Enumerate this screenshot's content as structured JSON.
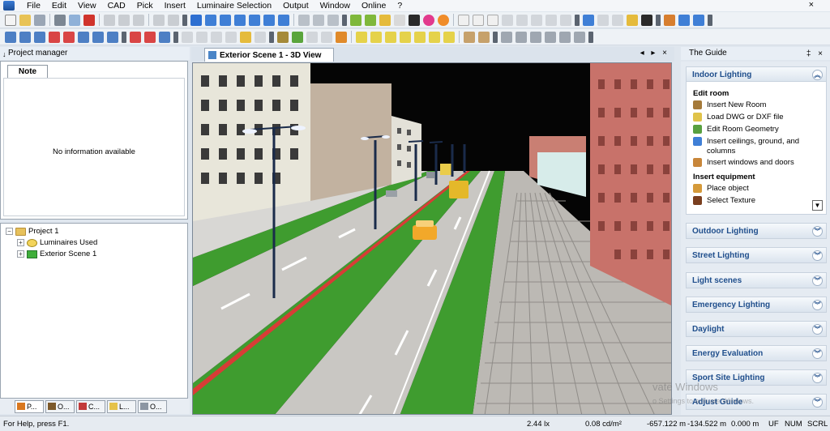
{
  "menu": {
    "items": [
      "File",
      "Edit",
      "View",
      "CAD",
      "Pick",
      "Insert",
      "Luminaire Selection",
      "Output",
      "Window",
      "Online",
      "?"
    ],
    "close_glyph": "×"
  },
  "project_manager": {
    "title": "Project manager",
    "pin_glyph": "↓",
    "note_tab": "Note",
    "note_message": "No information available",
    "tree": {
      "root": "Project 1",
      "children": [
        "Luminaires Used",
        "Exterior Scene 1"
      ]
    },
    "bottom_tabs": [
      "P...",
      "O...",
      "C...",
      "L...",
      "O..."
    ]
  },
  "document": {
    "tab_title": "Exterior Scene 1 - 3D View",
    "controls": "◂ ▸ ×"
  },
  "guide": {
    "title": "The Guide",
    "controls": "‡ ×",
    "active_section": "Indoor Lighting",
    "edit_room_header": "Edit room",
    "edit_room_items": [
      "Insert New Room",
      "Load DWG or DXF file",
      "Edit Room Geometry",
      "Insert ceilings, ground, and columns",
      "Insert windows and doors"
    ],
    "insert_equipment_header": "Insert equipment",
    "insert_equipment_items": [
      "Place object",
      "Select Texture"
    ],
    "sections": [
      "Outdoor Lighting",
      "Street Lighting",
      "Light scenes",
      "Emergency Lighting",
      "Daylight",
      "Energy Evaluation",
      "Sport Site Lighting",
      "Adjust Guide"
    ],
    "chevron_up": "︽",
    "chevron_down": "︾",
    "scroll_glyph": "▼"
  },
  "status": {
    "help": "For Help, press F1.",
    "illuminance": "2.44 lx",
    "luminance": "0.08 cd/m²",
    "x": "-657.122 m",
    "y": "-134.522 m",
    "z": "0.000 m",
    "flags": [
      "UF",
      "NUM",
      "SCRL"
    ]
  },
  "watermark": {
    "line1": "vate Windows",
    "line2": "o Settings to activate Windows."
  },
  "colors": {
    "accent": "#1f4e8c",
    "grass": "#3f9c2f",
    "road": "#c9c7c3",
    "building_pink": "#c8726a",
    "sky": "#050505"
  }
}
